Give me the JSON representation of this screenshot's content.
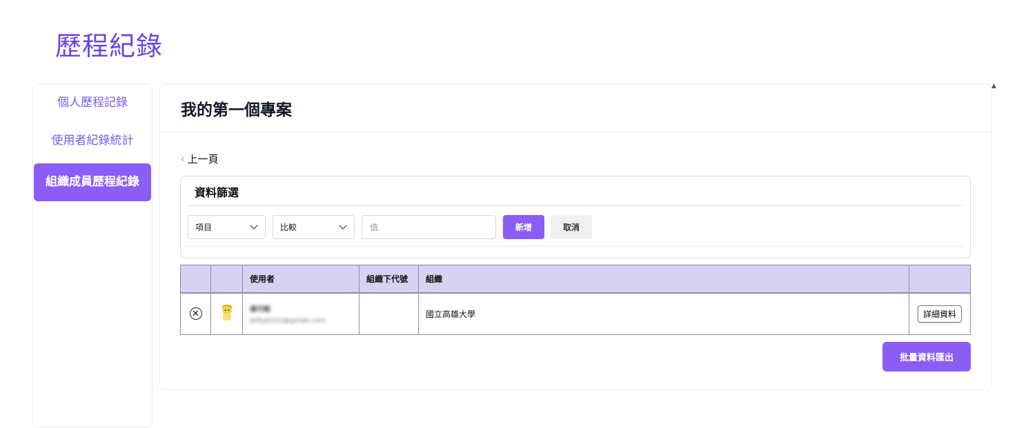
{
  "page": {
    "title": "歷程紀錄"
  },
  "sidebar": {
    "items": [
      {
        "label": "個人歷程記錄",
        "active": false
      },
      {
        "label": "使用者紀錄統計",
        "active": false
      },
      {
        "label": "組織成員歷程紀錄",
        "active": true
      }
    ]
  },
  "main": {
    "title": "我的第一個專案",
    "back_label": "上一頁",
    "filter": {
      "title": "資料篩選",
      "field_select": "項目",
      "compare_select": "比較",
      "value_placeholder": "值",
      "add_label": "新增",
      "cancel_label": "取消"
    },
    "table": {
      "columns": [
        "",
        "",
        "使用者",
        "組織下代號",
        "組織",
        ""
      ],
      "rows": [
        {
          "user_name": "楊可甄",
          "user_email": "willy0101@gmail.com",
          "org_code": "",
          "organization": "國立高雄大學",
          "detail_label": "詳細資料"
        }
      ]
    },
    "export_label": "批量資料匯出"
  },
  "colors": {
    "accent": "#8b5cf6",
    "title": "#6b46e0",
    "table_header": "#d8d2f2"
  }
}
